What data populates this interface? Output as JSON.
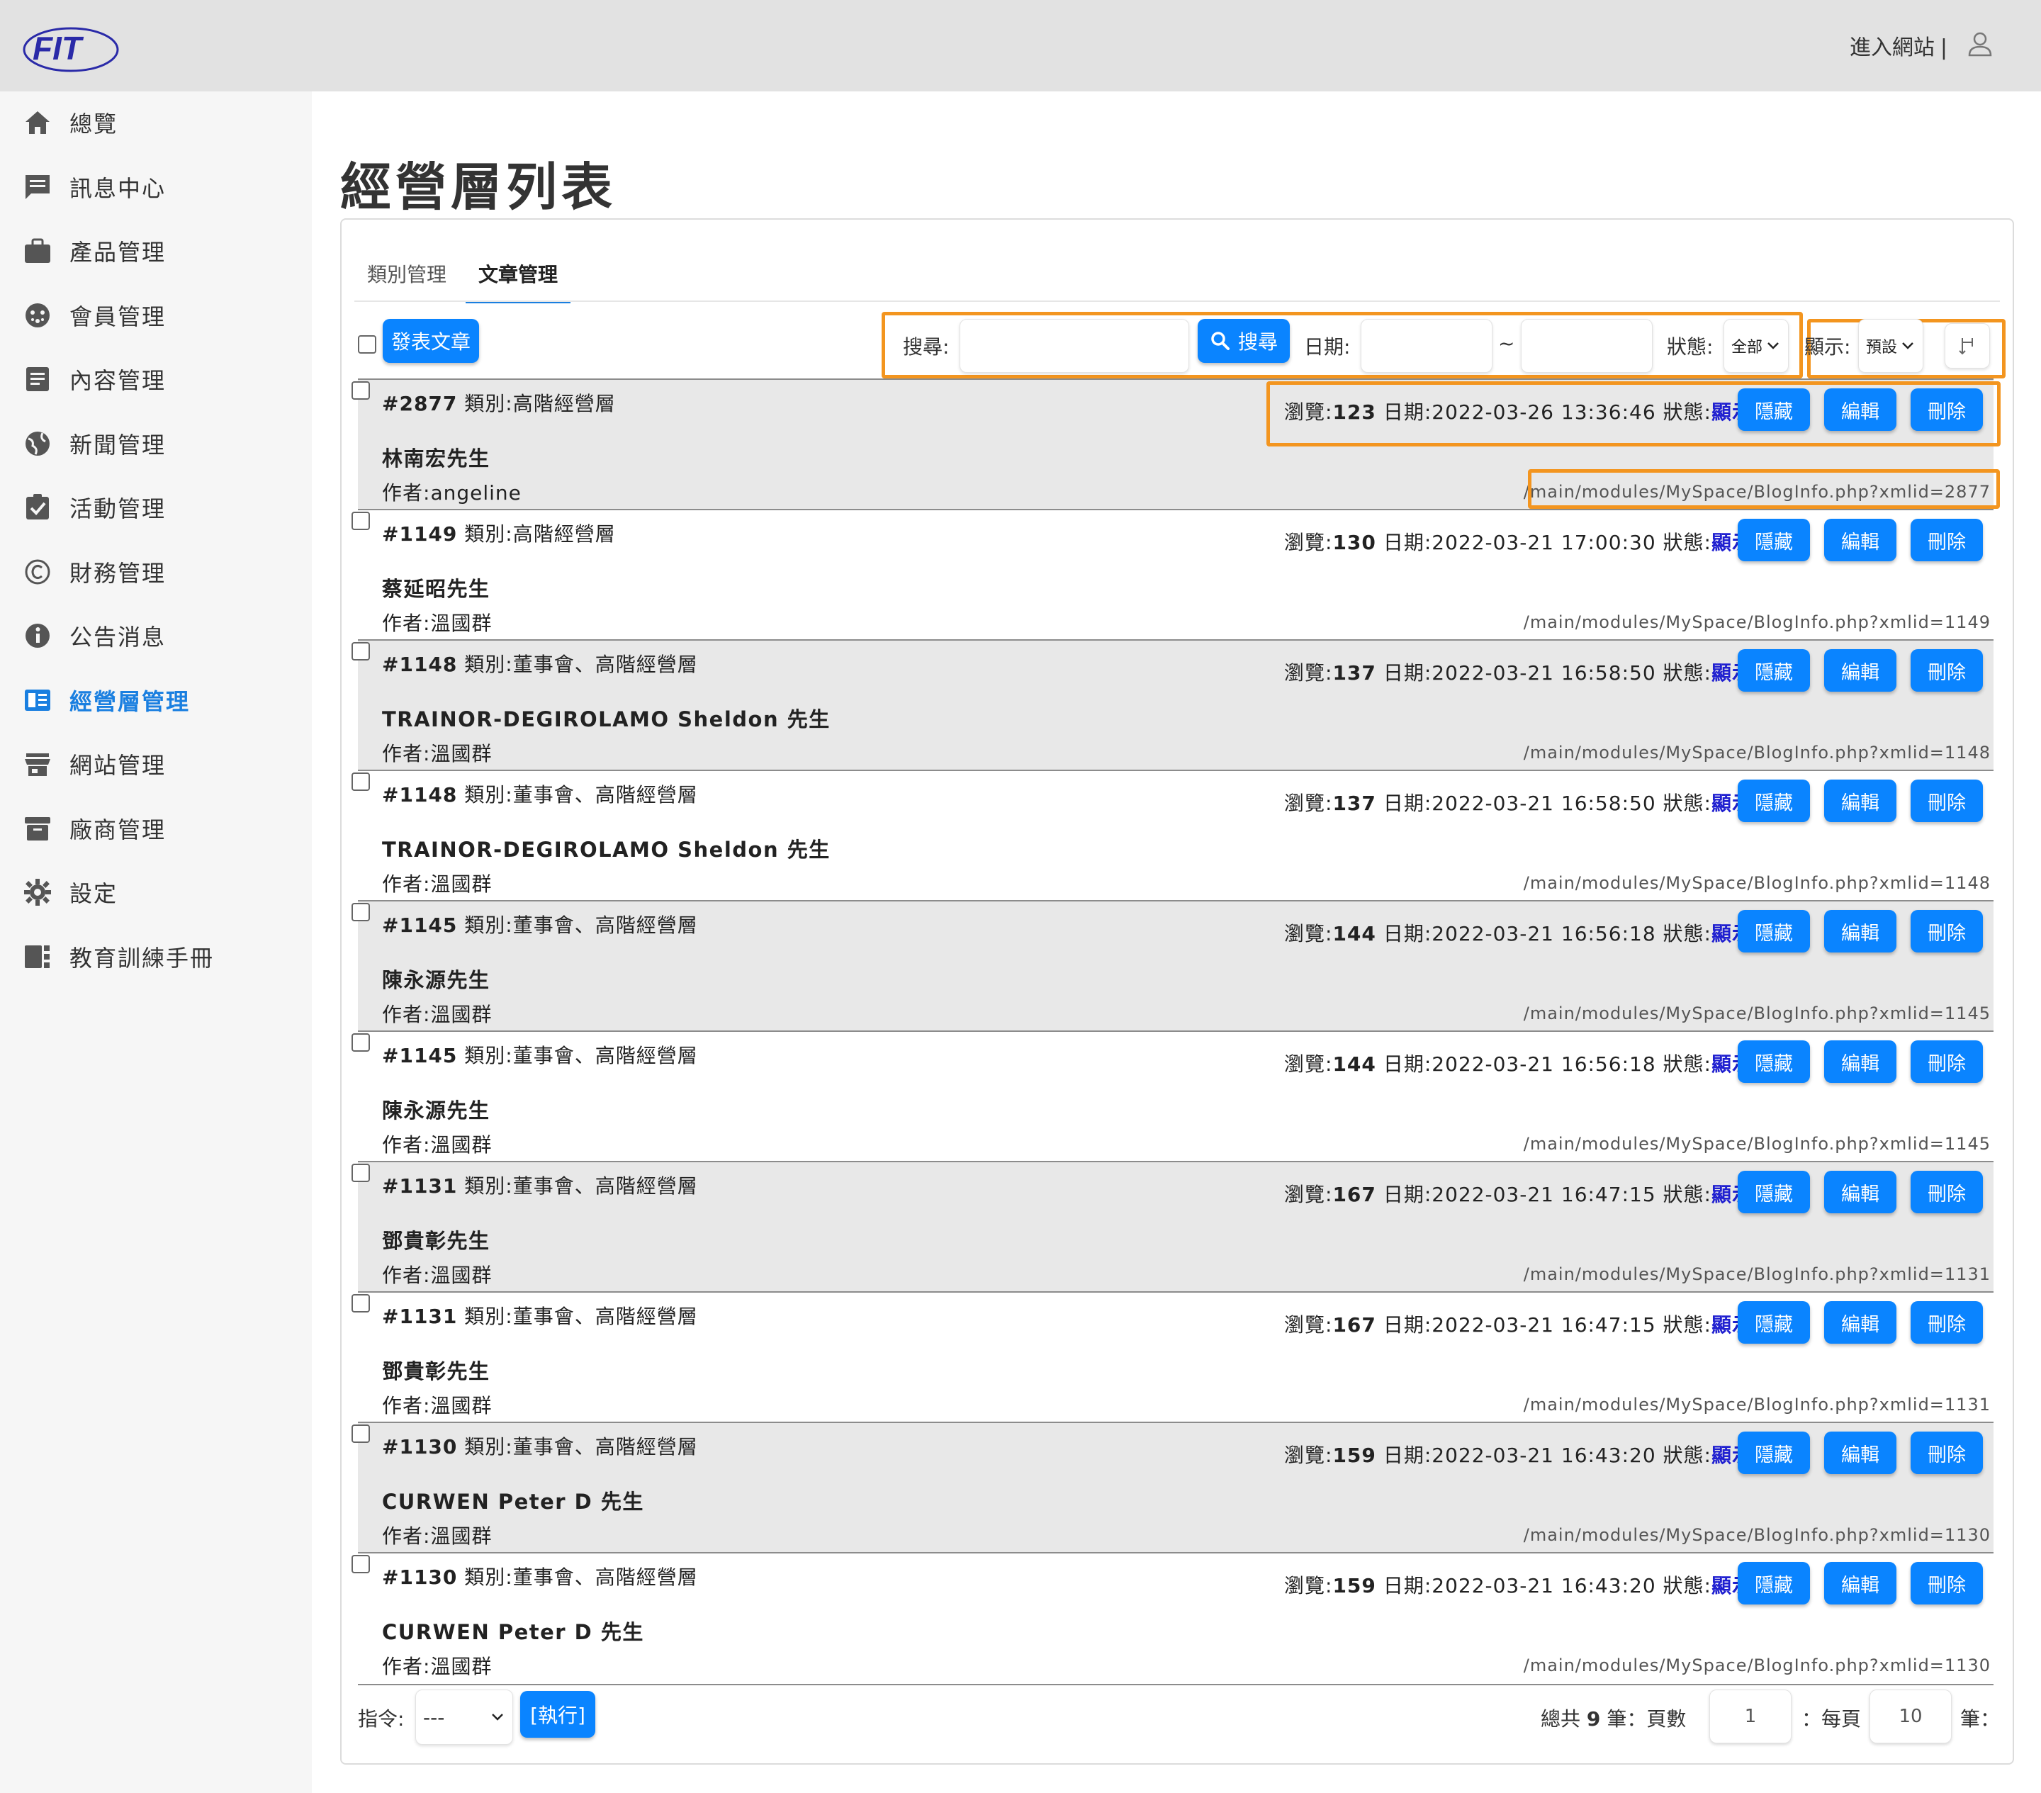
{
  "header": {
    "logo_text": "FIT",
    "enter_site": "進入網站",
    "separator": "|"
  },
  "sidebar": {
    "items": [
      {
        "label": "總覽",
        "icon": "home-icon"
      },
      {
        "label": "訊息中心",
        "icon": "message-icon"
      },
      {
        "label": "產品管理",
        "icon": "briefcase-icon"
      },
      {
        "label": "會員管理",
        "icon": "member-icon"
      },
      {
        "label": "內容管理",
        "icon": "document-icon"
      },
      {
        "label": "新聞管理",
        "icon": "globe-icon"
      },
      {
        "label": "活動管理",
        "icon": "checklist-icon"
      },
      {
        "label": "財務管理",
        "icon": "copyright-icon"
      },
      {
        "label": "公告消息",
        "icon": "info-icon"
      },
      {
        "label": "經營層管理",
        "icon": "book-icon",
        "active": true
      },
      {
        "label": "網站管理",
        "icon": "store-icon"
      },
      {
        "label": "廠商管理",
        "icon": "archive-icon"
      },
      {
        "label": "設定",
        "icon": "gear-icon"
      },
      {
        "label": "教育訓練手冊",
        "icon": "manual-icon"
      }
    ]
  },
  "page": {
    "title": "經營層列表",
    "tabs": [
      "類別管理",
      "文章管理"
    ],
    "active_tab": "文章管理"
  },
  "toolbar": {
    "publish_button": "發表文章",
    "search_label": "搜尋:",
    "search_value": "",
    "search_button": "搜尋",
    "date_label": "日期:",
    "date_from": "",
    "date_tilde": "~",
    "date_to": "",
    "status_label": "狀態:",
    "status_value": "全部",
    "display_label": "顯示:",
    "display_value": "預設"
  },
  "columns_labels": {
    "views": "瀏覽:",
    "date": "日期:",
    "status": "狀態:",
    "category": "類別:",
    "author": "作者:"
  },
  "actions": {
    "hide": "隱藏",
    "edit": "編輯",
    "delete": "刪除"
  },
  "rows": [
    {
      "id": "#2877",
      "category": "高階經營層",
      "title": "林南宏先生",
      "author": "angeline",
      "views": "123",
      "date": "2022-03-26 13:36:46",
      "status": "顯示",
      "link": "/main/modules/MySpace/BlogInfo.php?xmlid=2877"
    },
    {
      "id": "#1149",
      "category": "高階經營層",
      "title": "蔡延昭先生",
      "author": "溫國群",
      "views": "130",
      "date": "2022-03-21 17:00:30",
      "status": "顯示",
      "link": "/main/modules/MySpace/BlogInfo.php?xmlid=1149"
    },
    {
      "id": "#1148",
      "category": "董事會、高階經營層",
      "title": "TRAINOR-DEGIROLAMO Sheldon 先生",
      "author": "溫國群",
      "views": "137",
      "date": "2022-03-21 16:58:50",
      "status": "顯示",
      "link": "/main/modules/MySpace/BlogInfo.php?xmlid=1148"
    },
    {
      "id": "#1148",
      "category": "董事會、高階經營層",
      "title": "TRAINOR-DEGIROLAMO Sheldon 先生",
      "author": "溫國群",
      "views": "137",
      "date": "2022-03-21 16:58:50",
      "status": "顯示",
      "link": "/main/modules/MySpace/BlogInfo.php?xmlid=1148"
    },
    {
      "id": "#1145",
      "category": "董事會、高階經營層",
      "title": "陳永源先生",
      "author": "溫國群",
      "views": "144",
      "date": "2022-03-21 16:56:18",
      "status": "顯示",
      "link": "/main/modules/MySpace/BlogInfo.php?xmlid=1145"
    },
    {
      "id": "#1145",
      "category": "董事會、高階經營層",
      "title": "陳永源先生",
      "author": "溫國群",
      "views": "144",
      "date": "2022-03-21 16:56:18",
      "status": "顯示",
      "link": "/main/modules/MySpace/BlogInfo.php?xmlid=1145"
    },
    {
      "id": "#1131",
      "category": "董事會、高階經營層",
      "title": "鄧貴彰先生",
      "author": "溫國群",
      "views": "167",
      "date": "2022-03-21 16:47:15",
      "status": "顯示",
      "link": "/main/modules/MySpace/BlogInfo.php?xmlid=1131"
    },
    {
      "id": "#1131",
      "category": "董事會、高階經營層",
      "title": "鄧貴彰先生",
      "author": "溫國群",
      "views": "167",
      "date": "2022-03-21 16:47:15",
      "status": "顯示",
      "link": "/main/modules/MySpace/BlogInfo.php?xmlid=1131"
    },
    {
      "id": "#1130",
      "category": "董事會、高階經營層",
      "title": "CURWEN Peter D 先生",
      "author": "溫國群",
      "views": "159",
      "date": "2022-03-21 16:43:20",
      "status": "顯示",
      "link": "/main/modules/MySpace/BlogInfo.php?xmlid=1130"
    },
    {
      "id": "#1130",
      "category": "董事會、高階經營層",
      "title": "CURWEN Peter D 先生",
      "author": "溫國群",
      "views": "159",
      "date": "2022-03-21 16:43:20",
      "status": "顯示",
      "link": "/main/modules/MySpace/BlogInfo.php?xmlid=1130"
    }
  ],
  "footer": {
    "command_label": "指令:",
    "command_value": "---",
    "execute_button": "[執行]",
    "total_prefix": "總共",
    "total_count": "9",
    "total_suffix": "筆：頁數",
    "page_value": "1",
    "per_page_label": "：每頁",
    "per_page_value": "10",
    "per_page_suffix": "筆："
  },
  "colors": {
    "accent": "#0a84ff",
    "highlight_border": "#f3951f",
    "status_link": "#2020d0",
    "header_bg": "#e2e2e2",
    "sidebar_bg": "#f6f6f6",
    "row_alt": "#e8e8e8"
  }
}
